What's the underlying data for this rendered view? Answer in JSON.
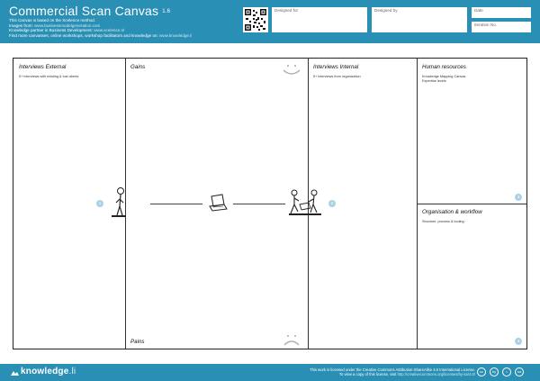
{
  "header": {
    "title": "Commercial Scan Canvas",
    "version": "1.6",
    "info_lines": [
      "This Canvas is based on the Xcelence method.",
      "Images from:",
      "Knowledge partner in Business Development:",
      "Find more canvasses, online workshops, workshop facilitators and knowledge on:"
    ],
    "info_links": [
      "www.businessmodelgeneration.com",
      "www.xcelence.nl",
      "www.knowledge.li"
    ],
    "fields": {
      "designed_for": "Designed for",
      "designed_by": "Designed by",
      "date": "Date",
      "iteration": "Iteration No."
    }
  },
  "blocks": {
    "interviews_external": {
      "title": "Interviews External",
      "sub": "5+ interviews with existing & lost clients",
      "number": "1"
    },
    "gains": {
      "title": "Gains"
    },
    "pains": {
      "title": "Pains"
    },
    "interviews_internal": {
      "title": "Interviews Internal",
      "sub": "5+ interviews from organization",
      "number": "2"
    },
    "human_resources": {
      "title": "Human resources",
      "sub1": "Knowledge Mapping Canvas",
      "sub2": "Expertise levels",
      "number": "3"
    },
    "organisation_workflow": {
      "title": "Organisation & workflow",
      "sub": "Structure, process & tooling",
      "number": "4"
    }
  },
  "footer": {
    "logo": "knowledge",
    "logo_tld": ".li",
    "license_line1": "This work is licensed under the Creative Commons Attribution-ShareAlike 4.0 International License.",
    "license_line2": "To view a copy of this license, visit",
    "license_link": "http://creativecommons.org/licenses/by-sa/4.0/",
    "cc_icons": [
      "cc",
      "by",
      "=",
      "sa"
    ]
  },
  "colors": {
    "brand": "#2a8fb4",
    "badge": "#a8d3e6",
    "line": "#333333"
  },
  "icons": [
    "qr-code-icon",
    "person-icon",
    "laptop-icon",
    "team-icon",
    "smile-icon",
    "sad-icon"
  ]
}
